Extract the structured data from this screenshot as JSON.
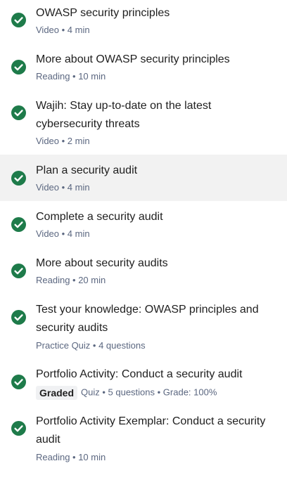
{
  "accent_color": "#1e7b4a",
  "items": [
    {
      "title": "OWASP security principles",
      "meta": "Video • 4 min",
      "status_icon": "check-circle-icon"
    },
    {
      "title": "More about OWASP security principles",
      "meta": "Reading • 10 min",
      "status_icon": "check-circle-icon"
    },
    {
      "title": "Wajih: Stay up-to-date on the latest cybersecurity threats",
      "meta": "Video • 2 min",
      "status_icon": "check-circle-icon"
    },
    {
      "title": "Plan a security audit",
      "meta": "Video • 4 min",
      "status_icon": "check-circle-icon",
      "highlighted": true
    },
    {
      "title": "Complete a security audit",
      "meta": "Video • 4 min",
      "status_icon": "check-circle-icon"
    },
    {
      "title": "More about security audits",
      "meta": "Reading • 20 min",
      "status_icon": "check-circle-icon"
    },
    {
      "title": "Test your knowledge: OWASP principles and security audits",
      "meta": "Practice Quiz • 4 questions",
      "status_icon": "check-circle-icon"
    },
    {
      "title": "Portfolio Activity: Conduct a security audit",
      "badge": "Graded",
      "meta": "Quiz • 5 questions • Grade: 100%",
      "status_icon": "check-circle-icon"
    },
    {
      "title": "Portfolio Activity Exemplar: Conduct a security audit",
      "meta": "Reading • 10 min",
      "status_icon": "check-circle-icon"
    }
  ]
}
